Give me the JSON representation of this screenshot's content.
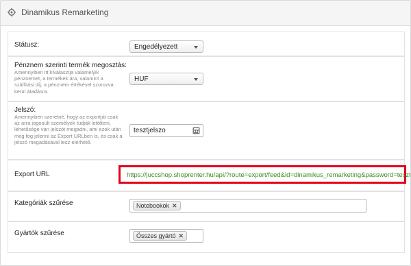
{
  "header": {
    "title": "Dinamikus Remarketing"
  },
  "status": {
    "label": "Státusz:",
    "selected": "Engedélyezett"
  },
  "currency": {
    "label": "Pénznem szerinti termék megosztás:",
    "help": "Amennyiben itt kiválasztja valamelyik pénznemet, a termékek ára, valamint a szállítási díj, a pénznem értékével szorozva kerül átadásra.",
    "selected": "HUF"
  },
  "password": {
    "label": "Jelszó:",
    "help": "Amennyiben szeretné, hogy az exportját csak az arra jogosult személyek tudják letölteni, lehetősége van jelszót megadni, ami ezek után meg fog jelenni az Export URLben is, és csak a jelszó megadásával lesz elérhető.",
    "value": "tesztjelszo"
  },
  "export": {
    "label": "Export URL",
    "url": "https://juccshop.shoprenter.hu/api/?route=export/feed&id=dinamikus_remarketing&password=tesztjelszo"
  },
  "categories": {
    "label": "Kategóriák szűrése",
    "tags": [
      "Notebookok"
    ]
  },
  "manufacturers": {
    "label": "Gyártók szűrése",
    "tags": [
      "Összes gyártó"
    ]
  },
  "colors": {
    "highlight": "#e3001b",
    "url": "#3b8b1f"
  }
}
